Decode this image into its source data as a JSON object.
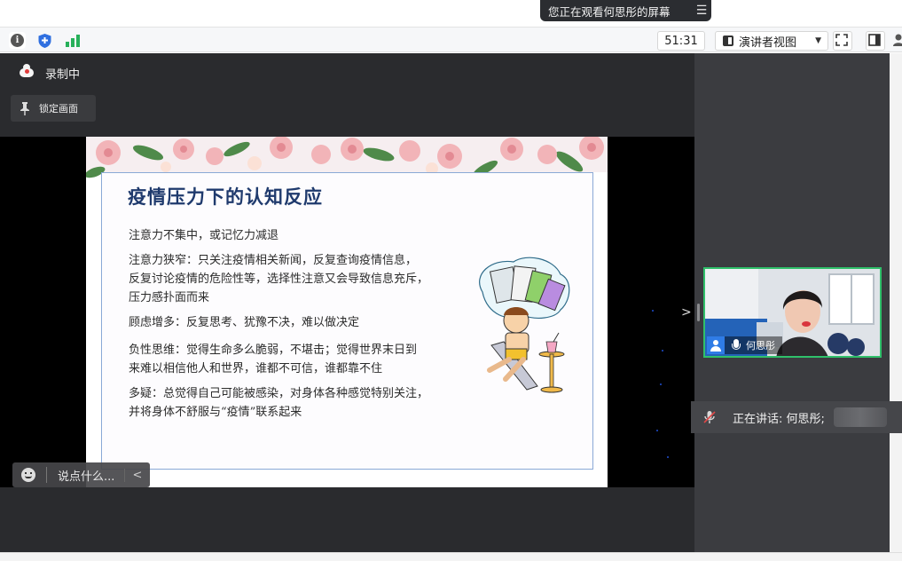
{
  "banner": {
    "text": "您正在观看何思彤的屏幕"
  },
  "toolbar": {
    "timer": "51:31",
    "view_label": "演讲者视图"
  },
  "status": {
    "recording": "录制中",
    "lock_screen": "锁定画面"
  },
  "slide": {
    "title": "疫情压力下的认知反应",
    "paragraphs": [
      {
        "lines": [
          "注意力不集中，或记忆力减退"
        ]
      },
      {
        "lines": [
          "注意力狭窄：只关注疫情相关新闻，反复查询疫情信息，",
          "反复讨论疫情的危险性等，选择性注意又会导致信息充斥，",
          "压力感扑面而来"
        ]
      },
      {
        "lines": [
          "顾虑增多：反复思考、犹豫不决，难以做决定"
        ]
      },
      {
        "lines": [
          "负性思维：觉得生命多么脆弱，不堪击；觉得世界末日到",
          "来难以相信他人和世界，谁都不可信，谁都靠不住"
        ]
      },
      {
        "lines": [
          "多疑：总觉得自己可能被感染，对身体各种感觉特别关注，",
          "并将身体不舒服与“疫情”联系起来"
        ]
      }
    ]
  },
  "chat": {
    "placeholder": "说点什么..."
  },
  "participant": {
    "name": "何思彤"
  },
  "speaking": {
    "text": "正在讲话: 何思彤;"
  },
  "colors": {
    "active_border": "#2fc06a",
    "panel_bg": "#2a2b2e",
    "title": "#1f3a6d"
  }
}
